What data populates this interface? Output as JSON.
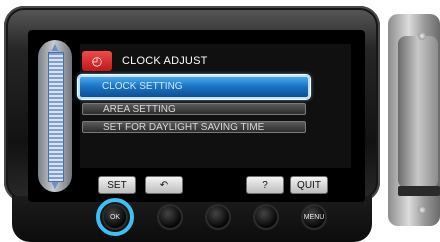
{
  "menu": {
    "title": "CLOCK ADJUST",
    "title_icon": "clock-icon",
    "items": [
      {
        "label": "CLOCK SETTING",
        "selected": true
      },
      {
        "label": "AREA SETTING",
        "selected": false
      },
      {
        "label": "SET FOR DAYLIGHT SAVING TIME",
        "selected": false
      }
    ]
  },
  "buttons": {
    "set": "SET",
    "back_icon": "return-arrow-icon",
    "help": "?",
    "quit": "QUIT"
  },
  "physical": {
    "ok": "OK",
    "menu": "MENU"
  },
  "colors": {
    "selection": "#1a73c4",
    "highlight_ring": "#3ec0f4",
    "title_icon_bg": "#d02020"
  }
}
